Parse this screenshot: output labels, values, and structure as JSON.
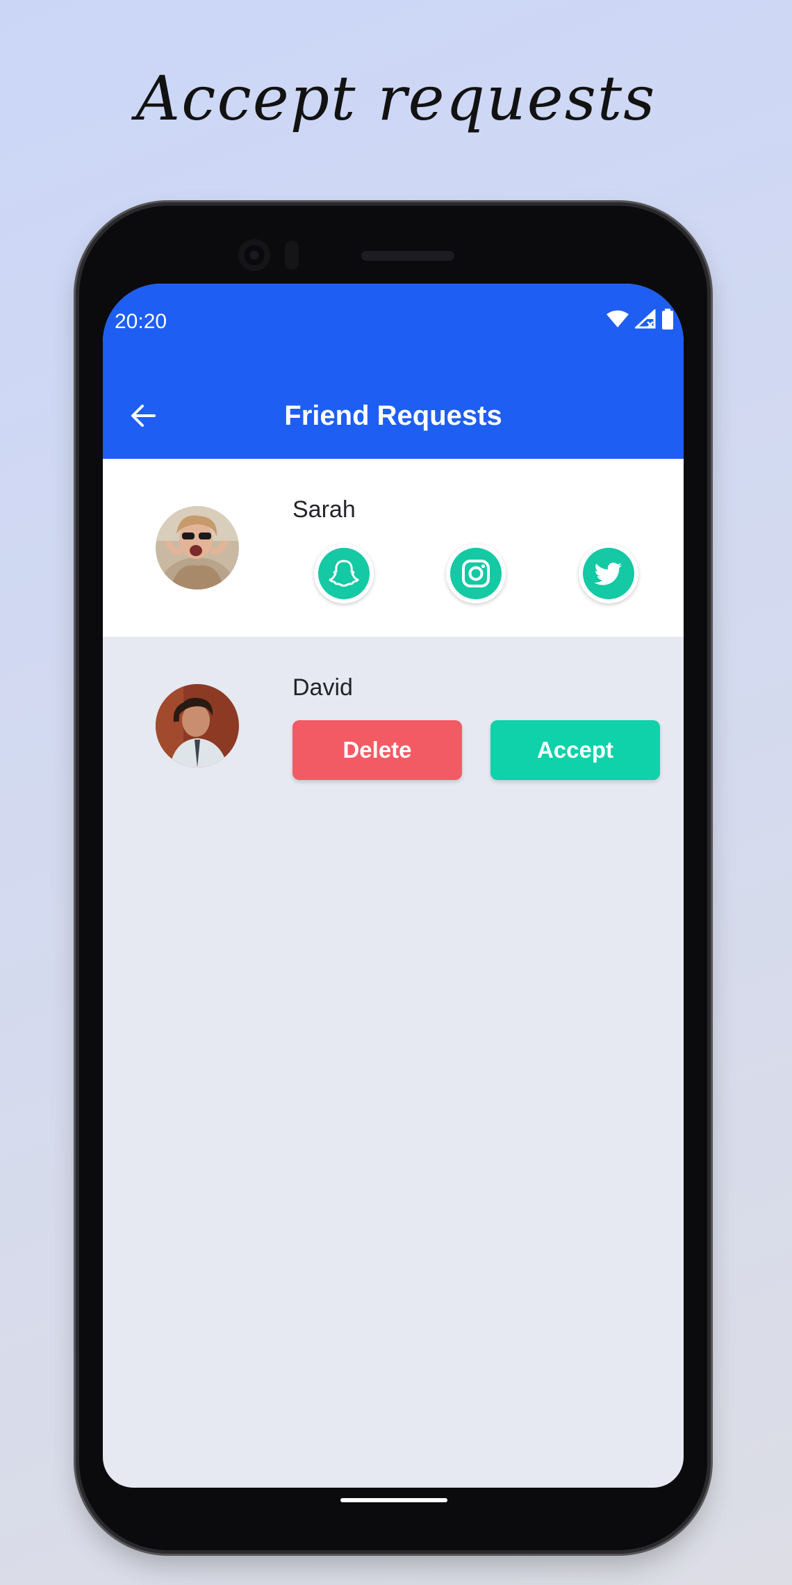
{
  "headline": "Accept requests",
  "status_bar": {
    "time": "20:20",
    "icons": [
      "wifi-icon",
      "cell-signal-icon",
      "battery-icon"
    ]
  },
  "app_bar": {
    "back_icon": "arrow-left-icon",
    "title": "Friend Requests",
    "color": "#1e5ef3"
  },
  "requests": [
    {
      "name": "Sarah",
      "state": "accepted",
      "socials": [
        "snapchat-icon",
        "instagram-icon",
        "twitter-icon"
      ],
      "social_color": "#14c9a4"
    },
    {
      "name": "David",
      "state": "pending",
      "actions": {
        "delete_label": "Delete",
        "accept_label": "Accept",
        "delete_color": "#f35b64",
        "accept_color": "#0fd1aa"
      }
    }
  ]
}
